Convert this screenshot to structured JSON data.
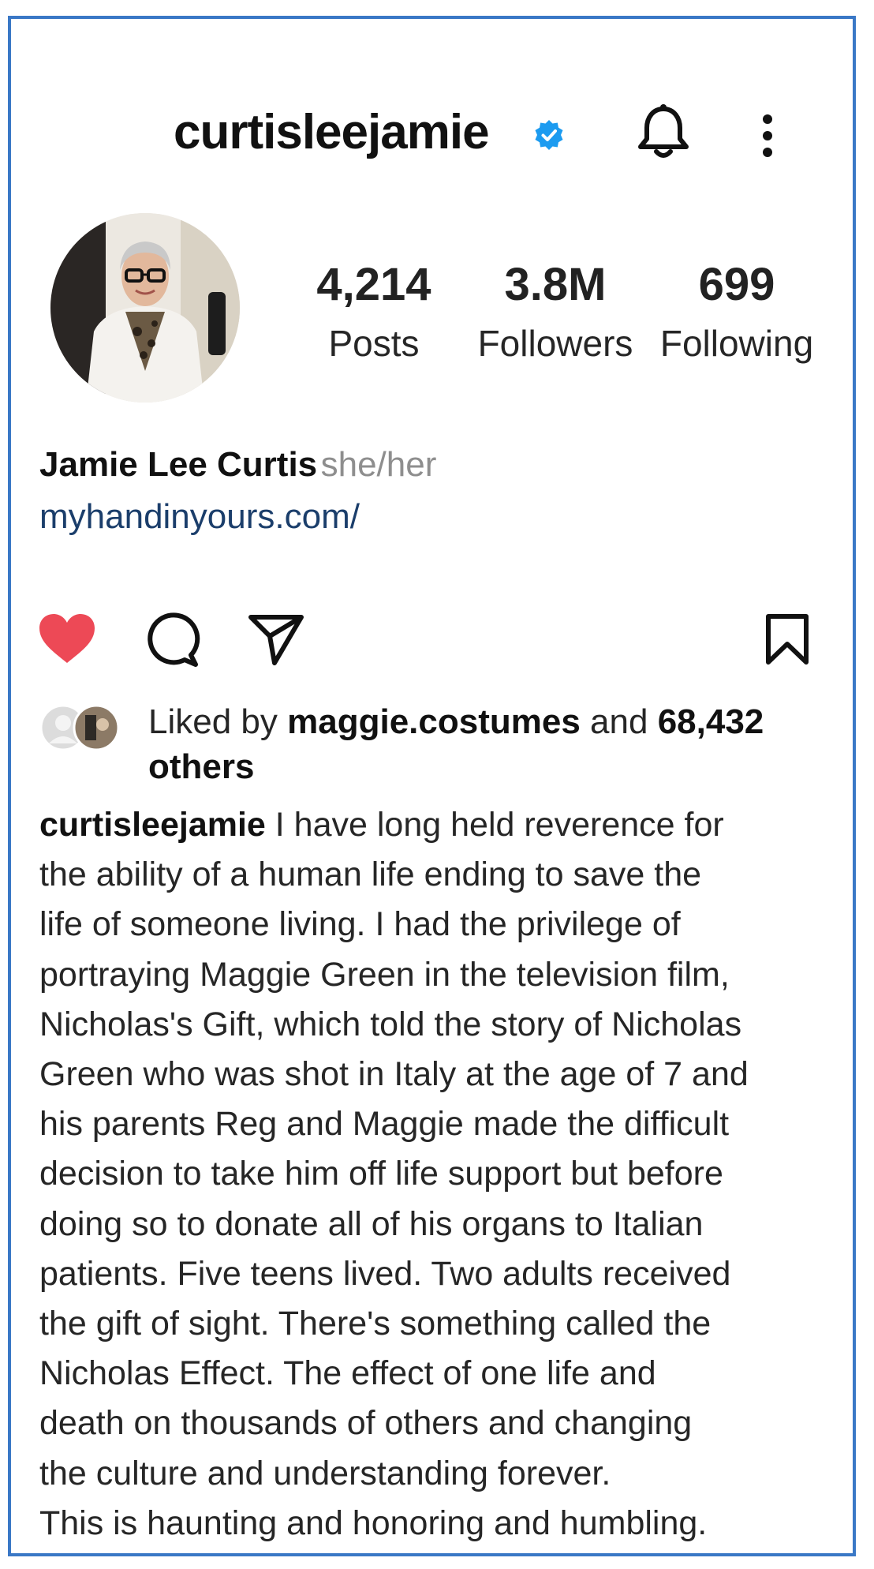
{
  "header": {
    "username": "curtisleejamie",
    "icons": {
      "verified": "verified-badge-icon",
      "notifications": "bell-icon",
      "menu": "more-vertical-icon"
    },
    "accent_color": "#1c9bf0"
  },
  "profile": {
    "avatar": "profile-photo",
    "stats": [
      {
        "value": "4,214",
        "label": "Posts"
      },
      {
        "value": "3.8M",
        "label": "Followers"
      },
      {
        "value": "699",
        "label": "Following"
      }
    ],
    "full_name": "Jamie Lee Curtis",
    "pronouns": "she/her",
    "link": "myhandinyours.com/"
  },
  "post": {
    "actions": {
      "like": "heart-filled-icon",
      "comment": "comment-icon",
      "share": "send-icon",
      "save": "bookmark-icon",
      "like_color": "#ed4956"
    },
    "likes": {
      "prefix": "Liked by",
      "user": "maggie.costumes",
      "conjunction": "and",
      "count": "68,432",
      "others_label": "others"
    },
    "caption": {
      "user": "curtisleejamie",
      "lines": [
        "I have long held reverence for",
        "the ability of a human life ending to save the",
        "life of someone living. I had the privilege of",
        "portraying Maggie Green in the television film,",
        "Nicholas's Gift, which told the story of Nicholas",
        "Green who was shot in Italy at the age of 7 and",
        "his parents Reg and Maggie made the difficult",
        "decision to take him off life support but before",
        "doing so to donate all of his organs to Italian",
        "patients. Five teens lived. Two adults received",
        "the gift of sight. There's something called the",
        "Nicholas Effect. The effect of one life and",
        "death on thousands of others and changing",
        "the culture and understanding forever.",
        "This is haunting and honoring and humbling."
      ]
    }
  }
}
